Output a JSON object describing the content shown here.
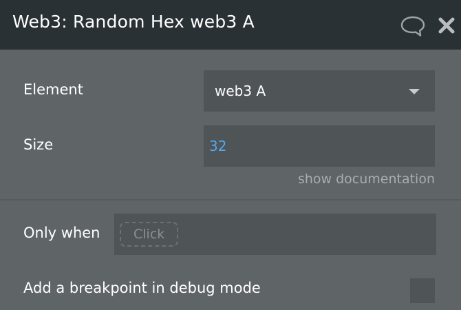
{
  "header": {
    "title": "Web3: Random Hex web3 A",
    "icons": [
      "comment-icon",
      "close-icon"
    ]
  },
  "fields": {
    "element": {
      "label": "Element",
      "value": "web3 A"
    },
    "size": {
      "label": "Size",
      "value": "32"
    },
    "show_documentation": "show documentation"
  },
  "condition": {
    "only_when_label": "Only when",
    "placeholder_chip": "Click"
  },
  "debug": {
    "breakpoint_label": "Add a breakpoint in debug mode",
    "checked": false
  },
  "colors": {
    "header_bg": "#2a3134",
    "panel_bg": "#5f6467",
    "field_bg": "#4f5456",
    "accent_value": "#56a6f2"
  }
}
